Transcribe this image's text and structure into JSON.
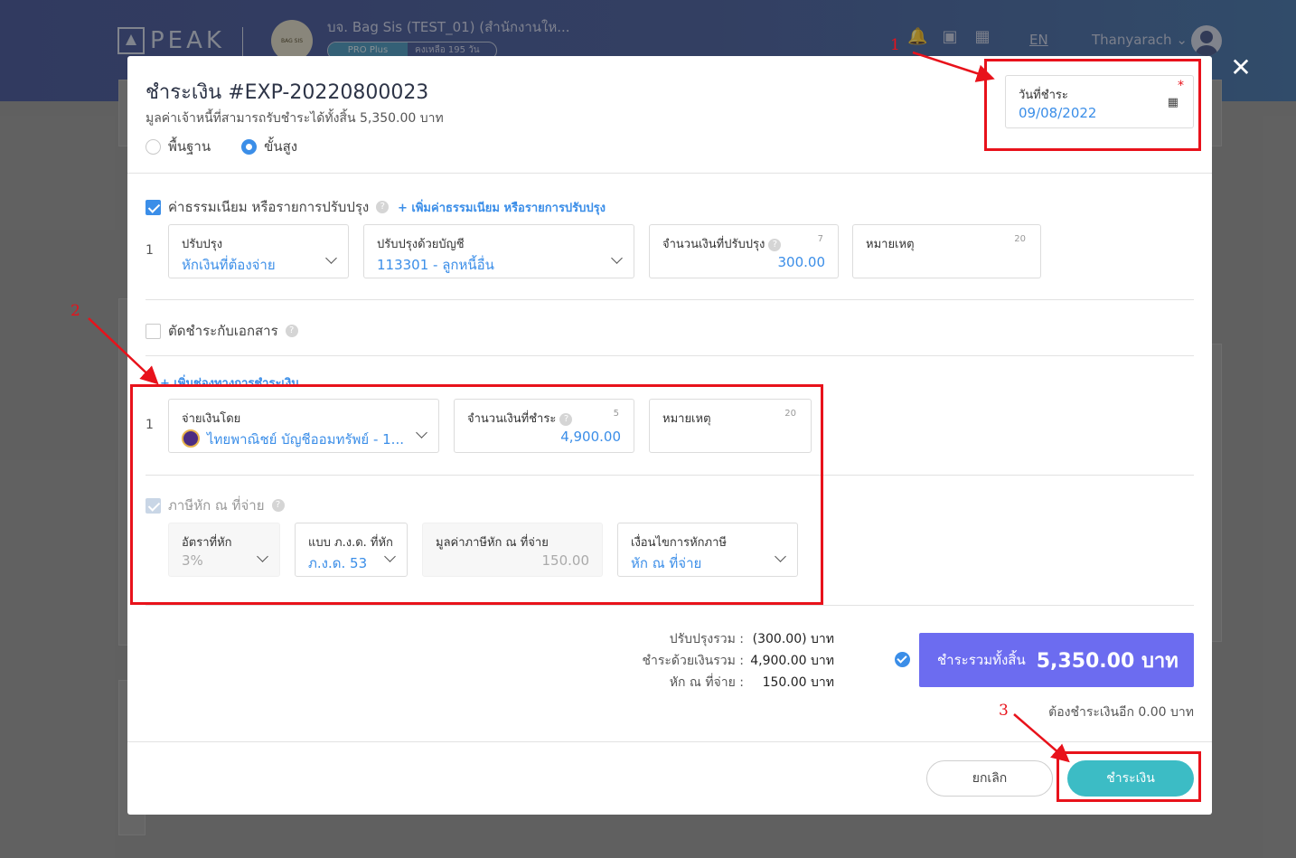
{
  "app": {
    "logo_text": "PEAK",
    "company_name": "บจ. Bag Sis (TEST_01) (สำนักงานให...",
    "company_avatar_text": "BAG SIS",
    "plan_name": "PRO Plus",
    "plan_remaining": "คงเหลือ 195 วัน",
    "lang": "EN",
    "username": "Thanyarach"
  },
  "modal": {
    "title": "ชำระเงิน #EXP-20220800023",
    "subtitle": "มูลค่าเจ้าหนี้ที่สามารถรับชำระได้ทั้งสิ้น 5,350.00 บาท",
    "mode_basic": "พื้นฐาน",
    "mode_advanced": "ขั้นสูง",
    "pay_date": {
      "label": "วันที่ชำระ",
      "required_mark": "*",
      "value": "09/08/2022"
    },
    "fees": {
      "label": "ค่าธรรมเนียม หรือรายการปรับปรุง",
      "add_link": "+ เพิ่มค่าธรรมเนียม หรือรายการปรับปรุง",
      "row_num": "1",
      "adjust": {
        "label": "ปรับปรุง",
        "value": "หักเงินที่ต้องจ่าย"
      },
      "account": {
        "label": "ปรับปรุงด้วยบัญชี",
        "value": "113301 - ลูกหนี้อื่น"
      },
      "amount": {
        "label": "จำนวนเงินที่ปรับปรุง",
        "count": "7",
        "value": "300.00"
      },
      "note": {
        "label": "หมายเหตุ",
        "count": "20"
      }
    },
    "match_doc": {
      "label": "ตัดชำระกับเอกสาร"
    },
    "add_channel": "+ เพิ่มช่องทางการชำระเงิน",
    "payment": {
      "row_num": "1",
      "method": {
        "label": "จ่ายเงินโดย",
        "value": "ไทยพาณิชย์ บัญชีออมทรัพย์ - 1..."
      },
      "amount": {
        "label": "จำนวนเงินที่ชำระ",
        "count": "5",
        "value": "4,900.00"
      },
      "note": {
        "label": "หมายเหตุ",
        "count": "20"
      }
    },
    "wht": {
      "label": "ภาษีหัก ณ ที่จ่าย",
      "rate": {
        "label": "อัตราที่หัก",
        "value": "3%"
      },
      "form": {
        "label": "แบบ ภ.ง.ด. ที่หัก",
        "value": "ภ.ง.ด. 53"
      },
      "amount": {
        "label": "มูลค่าภาษีหัก ณ ที่จ่าย",
        "value": "150.00"
      },
      "condition": {
        "label": "เงื่อนไขการหักภาษี",
        "value": "หัก ณ ที่จ่าย"
      }
    },
    "summary": {
      "adjust_label": "ปรับปรุงรวม :",
      "adjust_value": "(300.00) บาท",
      "paid_label": "ชำระด้วยเงินรวม :",
      "paid_value": "4,900.00 บาท",
      "wht_label": "หัก ณ ที่จ่าย :",
      "wht_value": "150.00 บาท",
      "total_label": "ชำระรวมทั้งสิ้น",
      "total_value": "5,350.00 บาท",
      "remaining": "ต้องชำระเงินอีก 0.00 บาท"
    },
    "buttons": {
      "cancel": "ยกเลิก",
      "pay": "ชำระเงิน"
    }
  },
  "annotations": {
    "n1": "1",
    "n2": "2",
    "n3": "3"
  },
  "colors": {
    "accent": "#3b8ee8",
    "total_bg": "#6c6cf0",
    "pay_button": "#3cbcc5",
    "annotation": "#e8121b"
  }
}
